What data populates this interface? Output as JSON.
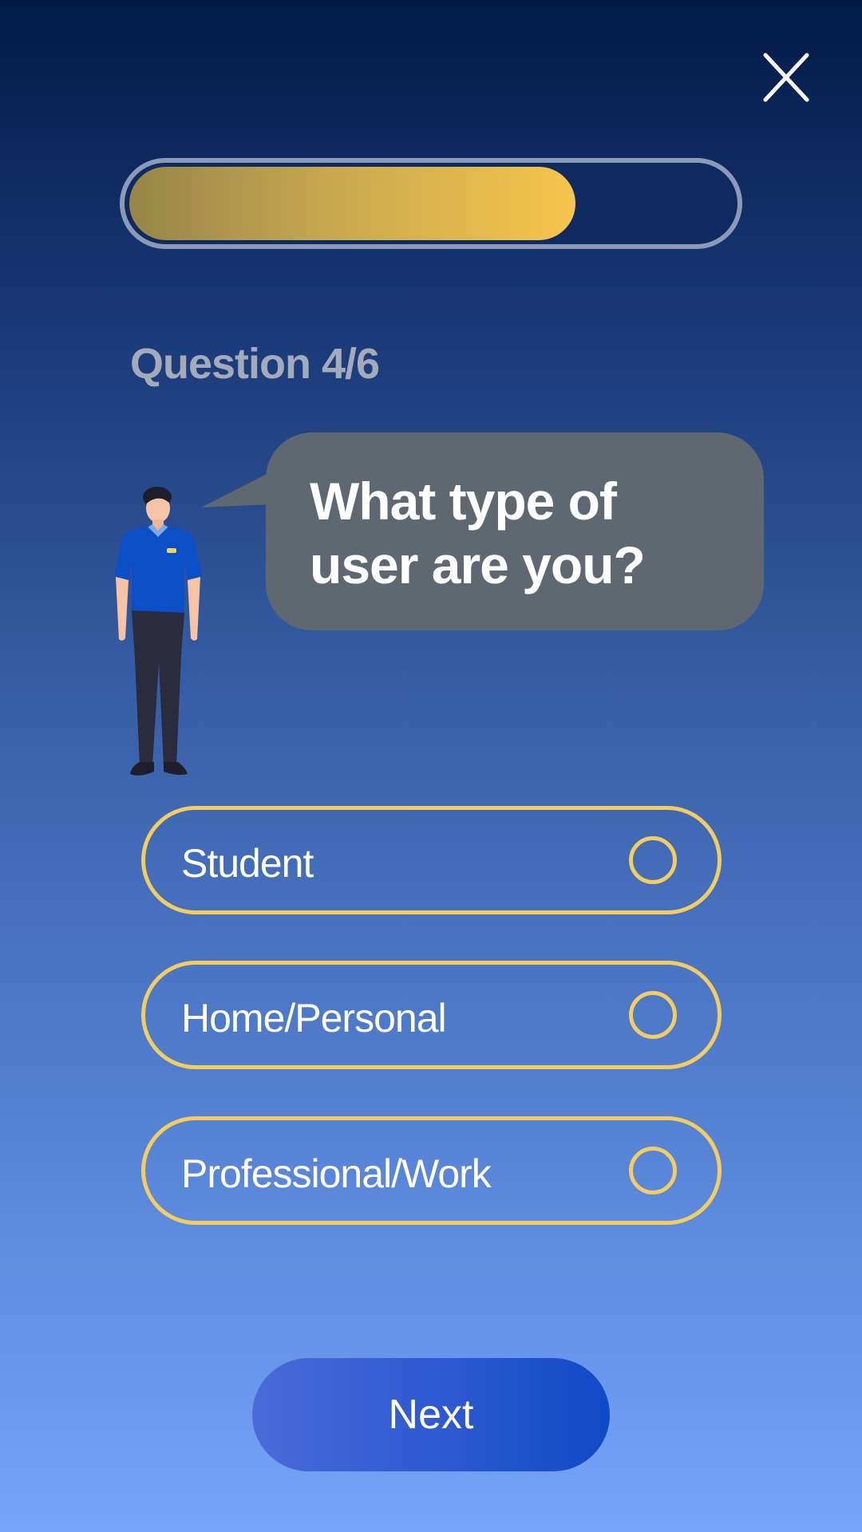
{
  "header": {
    "close_icon": "close-icon"
  },
  "progress": {
    "fraction": 0.74,
    "fill_color": "#f6c54c"
  },
  "question": {
    "label": "Question 4/6",
    "text": "What type of user are you?"
  },
  "options": [
    {
      "label": "Student",
      "selected": false
    },
    {
      "label": "Home/Personal",
      "selected": false
    },
    {
      "label": "Professional/Work",
      "selected": false
    }
  ],
  "footer": {
    "next_label": "Next"
  },
  "colors": {
    "accent_yellow": "#f4cd61",
    "bubble_gray": "#5f6870",
    "button_blue": "#0f4bc7"
  }
}
